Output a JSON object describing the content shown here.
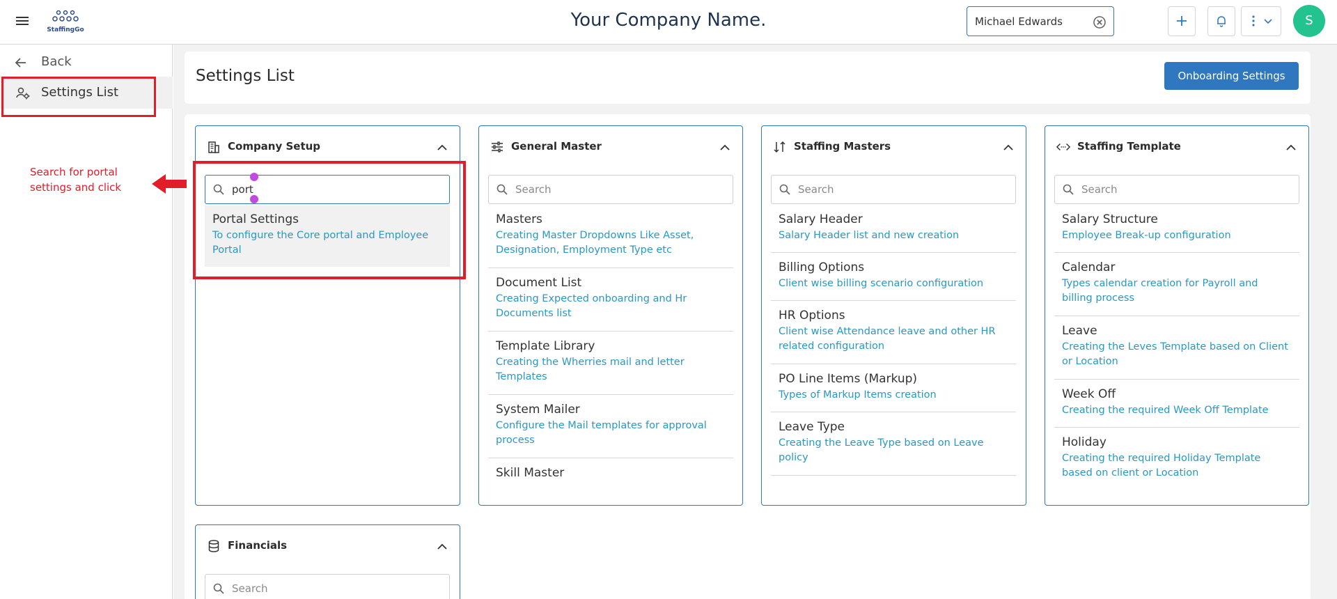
{
  "topbar": {
    "logo_text": "StaffingGo",
    "company_name": "Your Company Name.",
    "user_select_value": "Michael Edwards",
    "avatar_initial": "S"
  },
  "sidebar": {
    "back_label": "Back",
    "settings_label": "Settings List"
  },
  "annotation": {
    "text": "Search for portal settings and click"
  },
  "page": {
    "title": "Settings List",
    "onboarding_button": "Onboarding Settings"
  },
  "panels": {
    "company_setup": {
      "title": "Company Setup",
      "search_value": "port",
      "items": [
        {
          "title": "Portal Settings",
          "desc": "To configure the Core portal and Employee Portal"
        }
      ]
    },
    "general_master": {
      "title": "General Master",
      "search_placeholder": "Search",
      "items": [
        {
          "title": "Masters",
          "desc": "Creating Master Dropdowns Like Asset, Designation, Employment Type etc"
        },
        {
          "title": "Document List",
          "desc": "Creating Expected onboarding and Hr Documents list"
        },
        {
          "title": "Template Library",
          "desc": "Creating the Wherries mail and letter Templates"
        },
        {
          "title": "System Mailer",
          "desc": "Configure the Mail templates for approval process"
        },
        {
          "title": "Skill Master",
          "desc": ""
        }
      ]
    },
    "staffing_masters": {
      "title": "Staffing Masters",
      "search_placeholder": "Search",
      "items": [
        {
          "title": "Salary Header",
          "desc": "Salary Header list and new creation"
        },
        {
          "title": "Billing Options",
          "desc": "Client wise billing scenario configuration"
        },
        {
          "title": "HR Options",
          "desc": "Client wise Attendance leave and other HR related configuration"
        },
        {
          "title": "PO Line Items (Markup)",
          "desc": "Types of Markup Items creation"
        },
        {
          "title": "Leave Type",
          "desc": "Creating the Leave Type based on Leave policy"
        }
      ]
    },
    "staffing_template": {
      "title": "Staffing Template",
      "search_placeholder": "Search",
      "items": [
        {
          "title": "Salary Structure",
          "desc": "Employee Break-up configuration"
        },
        {
          "title": "Calendar",
          "desc": "Types calendar creation for Payroll and billing process"
        },
        {
          "title": "Leave",
          "desc": "Creating the Leves Template based on Client or Location"
        },
        {
          "title": "Week Off",
          "desc": "Creating the required Week Off Template"
        },
        {
          "title": "Holiday",
          "desc": "Creating the required Holiday Template based on client or Location"
        }
      ]
    },
    "financials": {
      "title": "Financials",
      "search_placeholder": "Search"
    }
  }
}
